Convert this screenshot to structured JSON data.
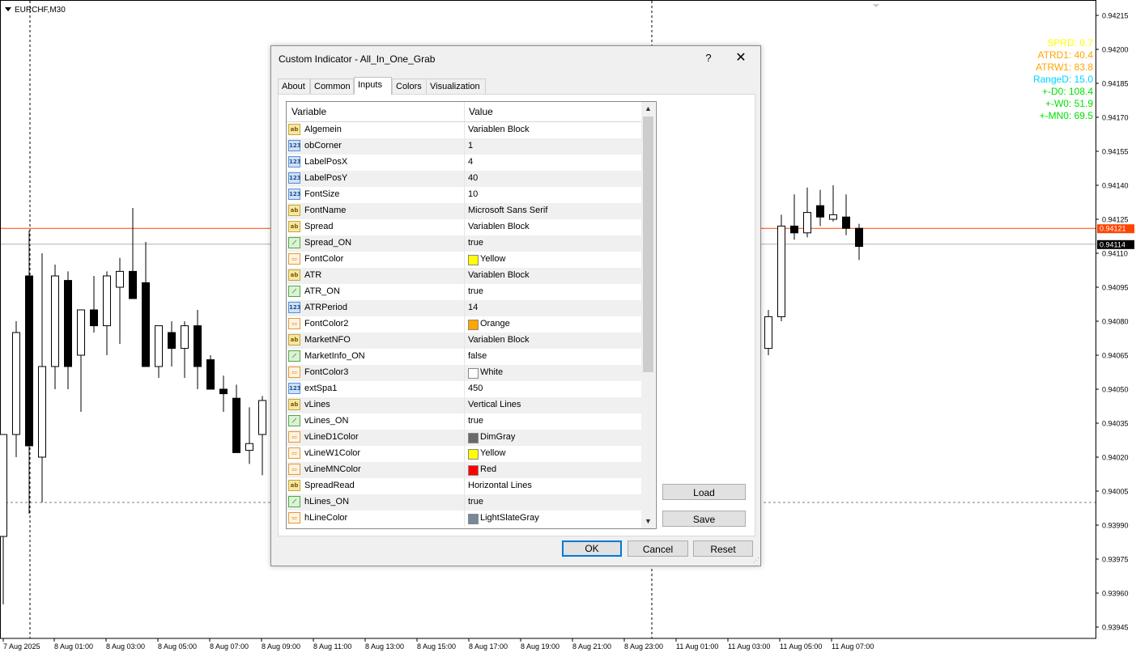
{
  "chart": {
    "title": "EURCHF,M30",
    "price_levels": [
      "0.94215",
      "0.94200",
      "0.94185",
      "0.94170",
      "0.94155",
      "0.94140",
      "0.94125",
      "0.94110",
      "0.94095",
      "0.94080",
      "0.94065",
      "0.94050",
      "0.94035",
      "0.94020",
      "0.94005",
      "0.93990",
      "0.93975",
      "0.93960",
      "0.93945"
    ],
    "current_price_red": "0.94121",
    "current_price_black": "0.94114",
    "time_labels": [
      "7 Aug 2025",
      "8 Aug 01:00",
      "8 Aug 03:00",
      "8 Aug 05:00",
      "8 Aug 07:00",
      "8 Aug 09:00",
      "8 Aug 11:00",
      "8 Aug 13:00",
      "8 Aug 15:00",
      "8 Aug 17:00",
      "8 Aug 19:00",
      "8 Aug 21:00",
      "8 Aug 23:00",
      "11 Aug 01:00",
      "11 Aug 03:00",
      "11 Aug 05:00",
      "11 Aug 07:00"
    ],
    "stats": [
      {
        "text": "SPRD: 0.7",
        "color": "#ffff00"
      },
      {
        "text": "ATRD1: 40.4",
        "color": "#ffa500"
      },
      {
        "text": "ATRW1: 83.8",
        "color": "#ffa500"
      },
      {
        "text": "RangeD: 15.0",
        "color": "#00d5ff"
      },
      {
        "text": "+-D0: 108.4",
        "color": "#00e000"
      },
      {
        "text": "+-W0: 51.9",
        "color": "#00e000"
      },
      {
        "text": "+-MN0: 69.5",
        "color": "#00e000"
      }
    ],
    "colors": {
      "bid_line": "#ff4400",
      "ask_line": "#b0b0b0",
      "candle": "#000000",
      "background": "#ffffff"
    }
  },
  "dialog": {
    "title": "Custom Indicator - All_In_One_Grab",
    "help_label": "?",
    "close_label": "✕",
    "tabs": [
      {
        "label": "About",
        "active": false
      },
      {
        "label": "Common",
        "active": false
      },
      {
        "label": "Inputs",
        "active": true
      },
      {
        "label": "Colors",
        "active": false
      },
      {
        "label": "Visualization",
        "active": false
      }
    ],
    "grid": {
      "col_variable": "Variable",
      "col_value": "Value",
      "rows": [
        {
          "icon": "ab",
          "name": "Algemein",
          "value": "Variablen Block"
        },
        {
          "icon": "num",
          "name": "obCorner",
          "value": "1"
        },
        {
          "icon": "num",
          "name": "LabelPosX",
          "value": "4"
        },
        {
          "icon": "num",
          "name": "LabelPosY",
          "value": "40"
        },
        {
          "icon": "num",
          "name": "FontSize",
          "value": "10"
        },
        {
          "icon": "ab",
          "name": "FontName",
          "value": "Microsoft Sans Serif"
        },
        {
          "icon": "ab",
          "name": "Spread",
          "value": "Variablen Block"
        },
        {
          "icon": "bool",
          "name": "Spread_ON",
          "value": "true"
        },
        {
          "icon": "color",
          "name": "FontColor",
          "value": "Yellow",
          "swatch": "#ffff00"
        },
        {
          "icon": "ab",
          "name": "ATR",
          "value": "Variablen Block"
        },
        {
          "icon": "bool",
          "name": "ATR_ON",
          "value": "true"
        },
        {
          "icon": "num",
          "name": "ATRPeriod",
          "value": "14"
        },
        {
          "icon": "color",
          "name": "FontColor2",
          "value": "Orange",
          "swatch": "#ffa500"
        },
        {
          "icon": "ab",
          "name": "MarketNFO",
          "value": "Variablen Block"
        },
        {
          "icon": "bool",
          "name": "MarketInfo_ON",
          "value": "false"
        },
        {
          "icon": "color",
          "name": "FontColor3",
          "value": "White",
          "swatch": "#ffffff"
        },
        {
          "icon": "num",
          "name": "extSpa1",
          "value": "450"
        },
        {
          "icon": "ab",
          "name": "vLines",
          "value": "Vertical Lines"
        },
        {
          "icon": "bool",
          "name": "vLines_ON",
          "value": "true"
        },
        {
          "icon": "color",
          "name": "vLineD1Color",
          "value": "DimGray",
          "swatch": "#696969"
        },
        {
          "icon": "color",
          "name": "vLineW1Color",
          "value": "Yellow",
          "swatch": "#ffff00"
        },
        {
          "icon": "color",
          "name": "vLineMNColor",
          "value": "Red",
          "swatch": "#ff0000"
        },
        {
          "icon": "ab",
          "name": "SpreadRead",
          "value": "Horizontal Lines"
        },
        {
          "icon": "bool",
          "name": "hLines_ON",
          "value": "true"
        },
        {
          "icon": "color",
          "name": "hLineColor",
          "value": "LightSlateGray",
          "swatch": "#778899"
        }
      ]
    },
    "buttons": {
      "load": "Load",
      "save": "Save",
      "ok": "OK",
      "cancel": "Cancel",
      "reset": "Reset"
    },
    "icon_glyphs": {
      "ab": "ab",
      "num": "123",
      "bool": "⟋",
      "color": "▭"
    }
  }
}
